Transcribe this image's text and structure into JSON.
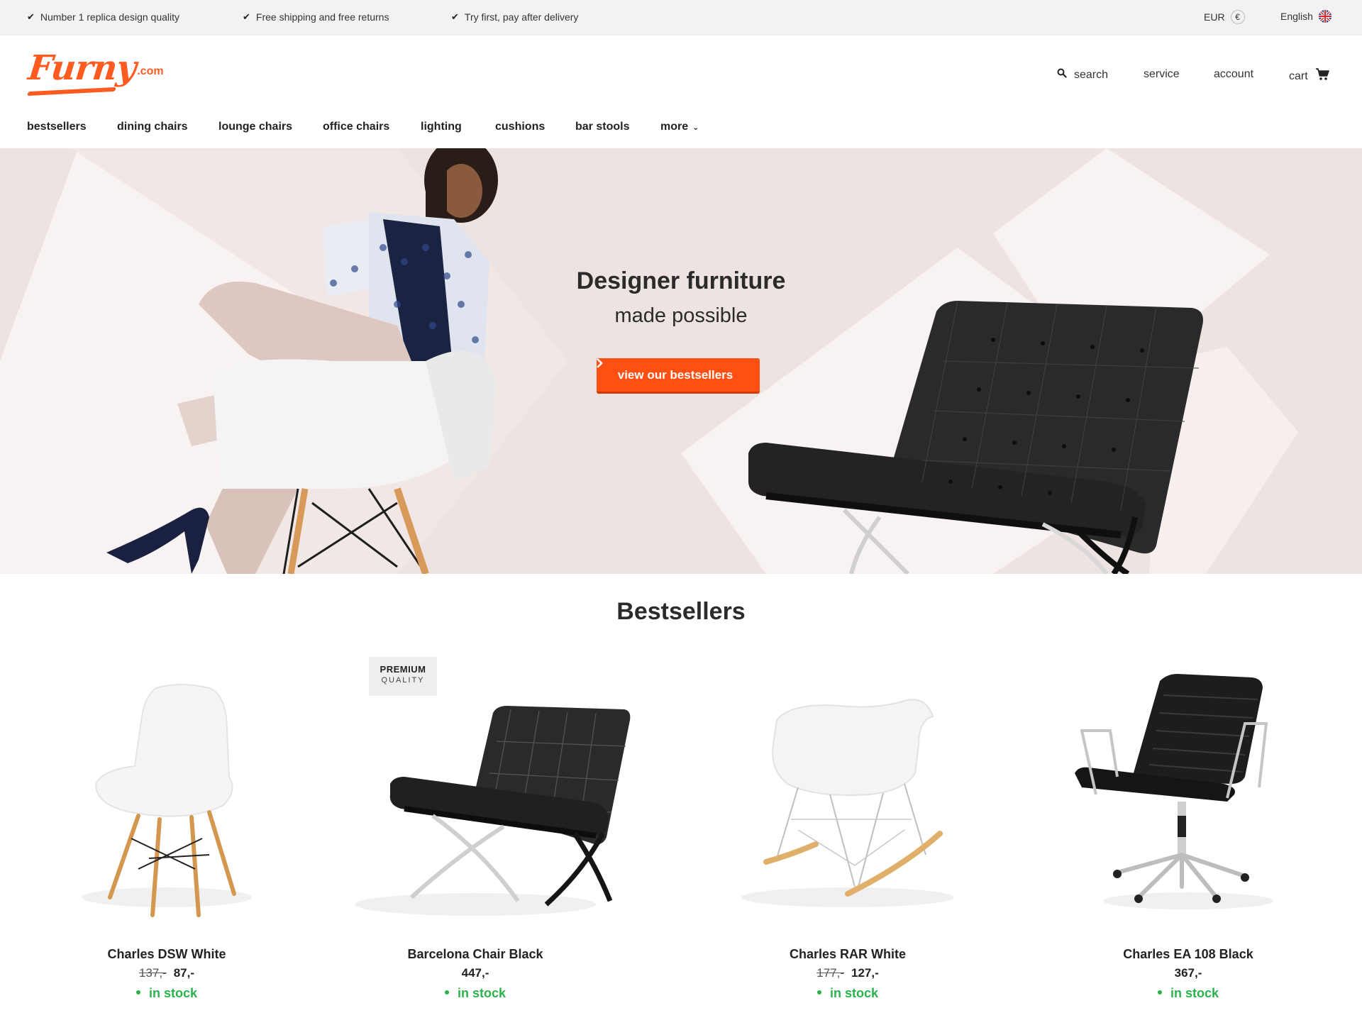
{
  "topbar": {
    "usps": [
      "Number 1 replica design quality",
      "Free shipping and free returns",
      "Try first, pay after delivery"
    ],
    "currency": "EUR",
    "currency_symbol": "€",
    "language": "English"
  },
  "header": {
    "logo_text": "Furny",
    "logo_suffix": ".com",
    "links": {
      "search": "search",
      "service": "service",
      "account": "account",
      "cart": "cart"
    }
  },
  "nav": {
    "items": [
      "bestsellers",
      "dining chairs",
      "lounge chairs",
      "office chairs",
      "lighting",
      "cushions",
      "bar stools",
      "more"
    ]
  },
  "hero": {
    "title": "Designer furniture",
    "subtitle": "made possible",
    "button_label": "view our bestsellers"
  },
  "bestsellers": {
    "title": "Bestsellers",
    "products": [
      {
        "name": "Charles DSW White",
        "old_price": "137,-",
        "price": "87,-",
        "stock": "in stock"
      },
      {
        "name": "Barcelona Chair Black",
        "old_price": "",
        "price": "447,-",
        "stock": "in stock",
        "badge_line1": "PREMIUM",
        "badge_line2": "QUALITY"
      },
      {
        "name": "Charles RAR White",
        "old_price": "177,-",
        "price": "127,-",
        "stock": "in stock"
      },
      {
        "name": "Charles EA 108 Black",
        "old_price": "",
        "price": "367,-",
        "stock": "in stock"
      }
    ]
  },
  "colors": {
    "accent": "#ff5a1f",
    "stock_green": "#2bb24c",
    "hero_bg": "#ede3e1"
  }
}
